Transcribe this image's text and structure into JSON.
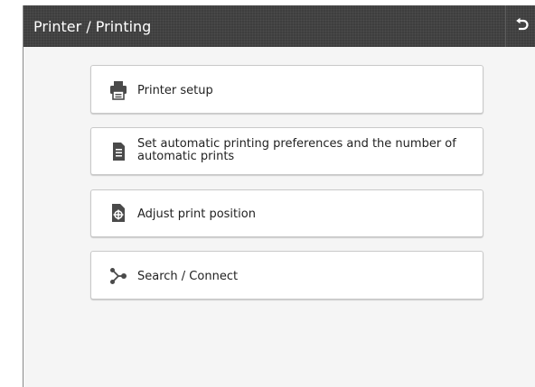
{
  "header": {
    "title": "Printer / Printing"
  },
  "menu": {
    "items": [
      {
        "label": "Printer setup",
        "icon": "printer-icon"
      },
      {
        "label": "Set automatic printing preferences and the number of automatic prints",
        "icon": "document-icon"
      },
      {
        "label": "Adjust print position",
        "icon": "print-position-icon"
      },
      {
        "label": "Search / Connect",
        "icon": "connect-icon"
      }
    ]
  },
  "colors": {
    "header_bg": "#3e3e3e",
    "panel_bg": "#f5f5f5",
    "button_bg": "#ffffff",
    "icon": "#4a4a4a"
  }
}
